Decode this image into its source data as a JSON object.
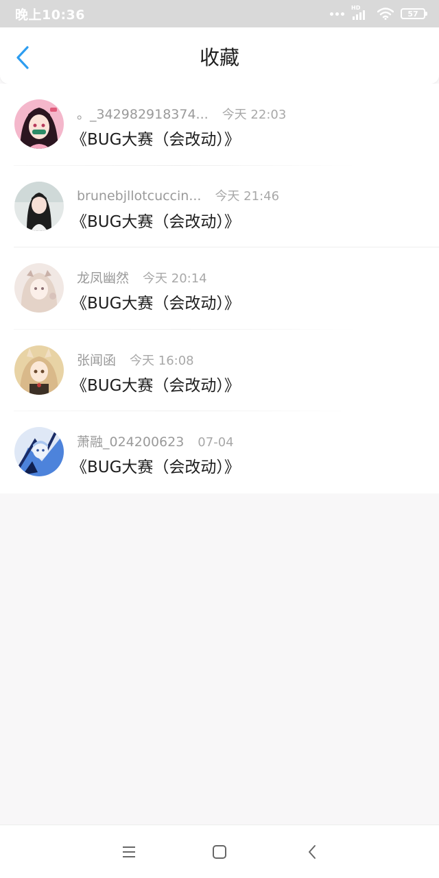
{
  "status_bar": {
    "time": "晚上10:36",
    "network_label": "HD",
    "battery": "57",
    "icons": [
      "more-dots-icon",
      "signal-icon",
      "wifi-icon",
      "battery-icon"
    ]
  },
  "header": {
    "title": "收藏",
    "back_icon": "chevron-left-icon",
    "accent_color": "#2d9df0"
  },
  "favorites": [
    {
      "user": "。_342982918374...",
      "time": "今天 22:03",
      "title": "《BUG大赛（会改动）》",
      "avatar_colors": [
        "#f3a7c0",
        "#3a2030"
      ]
    },
    {
      "user": "brunebjllotcuccin...",
      "time": "今天 21:46",
      "title": "《BUG大赛（会改动）》",
      "avatar_colors": [
        "#dfe5e3",
        "#2a2a2a"
      ]
    },
    {
      "user": "龙凤幽然",
      "time": "今天 20:14",
      "title": "《BUG大赛（会改动）》",
      "avatar_colors": [
        "#efe5e1",
        "#c9b6ad"
      ]
    },
    {
      "user": "张闻函",
      "time": "今天 16:08",
      "title": "《BUG大赛（会改动）》",
      "avatar_colors": [
        "#e7cf9e",
        "#6a4e3a"
      ]
    },
    {
      "user": "萧融_024200623",
      "time": "07-04",
      "title": "《BUG大赛（会改动）》",
      "avatar_colors": [
        "#5a8de0",
        "#0f2050"
      ]
    }
  ],
  "nav_bar": {
    "icons": [
      "menu-icon",
      "home-icon",
      "back-icon"
    ]
  }
}
